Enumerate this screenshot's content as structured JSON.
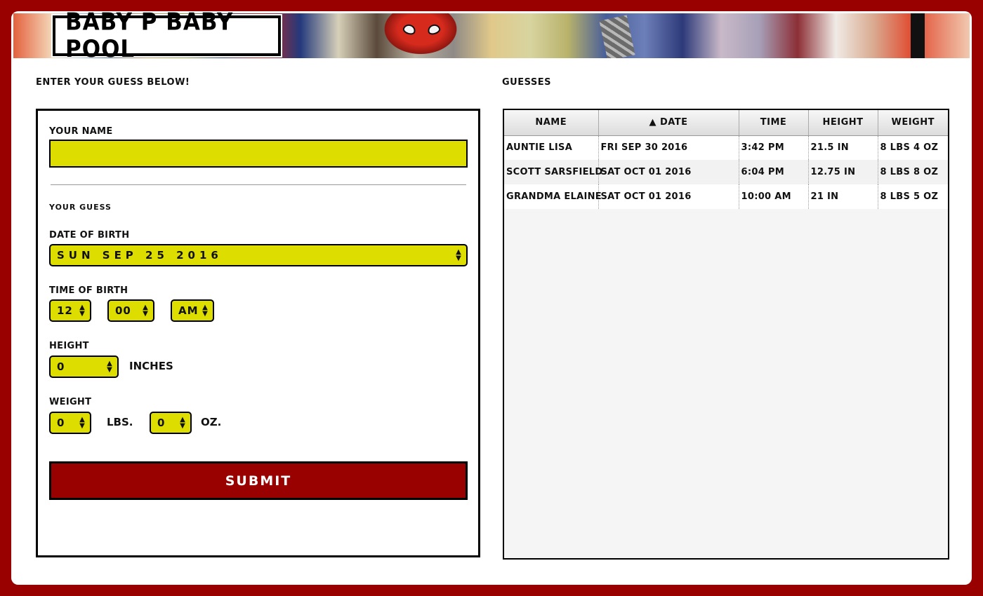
{
  "app": {
    "title": "Baby P Baby Pool"
  },
  "colors": {
    "background": "#990000",
    "input_yellow": "#dddd00",
    "submit": "#990000"
  },
  "form": {
    "heading": "Enter your guess below!",
    "name_label": "Your Name",
    "name_value": "",
    "name_placeholder": "",
    "guess_label": "Your Guess",
    "dob_label": "Date of Birth",
    "dob_value": "Sun Sep 25 2016",
    "time_label": "Time of Birth",
    "hour_value": "12",
    "minute_value": "00",
    "ampm_value": "AM",
    "height_label": "Height",
    "height_value": "0",
    "height_unit": "inches",
    "weight_label": "Weight",
    "lbs_value": "0",
    "lbs_unit": "lbs.",
    "oz_value": "0",
    "oz_unit": "oz.",
    "submit_label": "Submit"
  },
  "guesses": {
    "heading": "Guesses",
    "columns": [
      "Name",
      "▲ Date",
      "Time",
      "Height",
      "Weight"
    ],
    "rows": [
      [
        "Auntie Lisa",
        "Fri Sep 30 2016",
        "3:42 PM",
        "21.5 in",
        "8 lbs 4 oz"
      ],
      [
        "Scott Sarsfield",
        "Sat Oct 01 2016",
        "6:04 PM",
        "12.75 in",
        "8 lbs 8 oz"
      ],
      [
        "Grandma Elaine",
        "Sat Oct 01 2016",
        "10:00 AM",
        "21 in",
        "8 lbs 5 oz"
      ]
    ]
  }
}
